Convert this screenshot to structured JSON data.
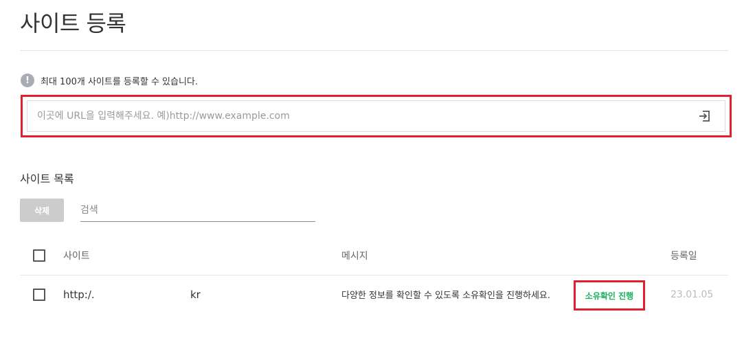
{
  "page": {
    "title": "사이트 등록"
  },
  "notice": {
    "icon": "info-icon",
    "icon_glyph": "!",
    "text": "최대 100개 사이트를 등록할 수 있습니다."
  },
  "url_input": {
    "placeholder": "이곳에 URL을 입력해주세요. 예)http://www.example.com",
    "value": "",
    "submit_icon": "enter-icon"
  },
  "site_list": {
    "title": "사이트 목록",
    "delete_label": "삭제",
    "search_placeholder": "검색",
    "columns": {
      "site": "사이트",
      "message": "메시지",
      "date": "등록일"
    },
    "rows": [
      {
        "site_prefix": "http:/.",
        "site_suffix": "kr",
        "message": "다양한 정보를 확인할 수 있도록 소유확인을 진행하세요.",
        "action": "소유확인 진행",
        "date": "23.01.05"
      }
    ]
  },
  "colors": {
    "highlight_border": "#e0202c",
    "action_green": "#19b15a",
    "disabled_button": "#cccccc"
  }
}
